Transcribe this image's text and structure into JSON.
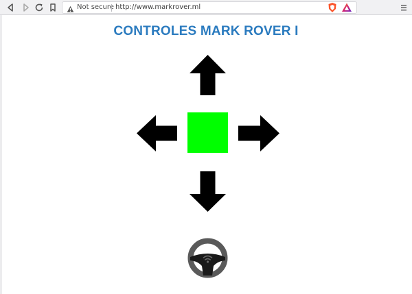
{
  "browser": {
    "security_label": "Not secure",
    "url": "http://www.markrover.ml",
    "icons": [
      "back-icon",
      "forward-icon",
      "reload-icon",
      "bookmark-icon",
      "warning-icon",
      "brave-shield-icon",
      "brave-rewards-icon",
      "menu-icon"
    ]
  },
  "page": {
    "title": "CONTROLES MARK ROVER I",
    "controls": [
      "arrow-up-icon",
      "arrow-left-icon",
      "arrow-right-icon",
      "arrow-down-icon",
      "steering-wheel-icon"
    ],
    "colors": {
      "title": "#2b7bbf",
      "stop_button": "#00ff00",
      "arrows": "#000000",
      "wheel": "#5a5a5a"
    }
  }
}
